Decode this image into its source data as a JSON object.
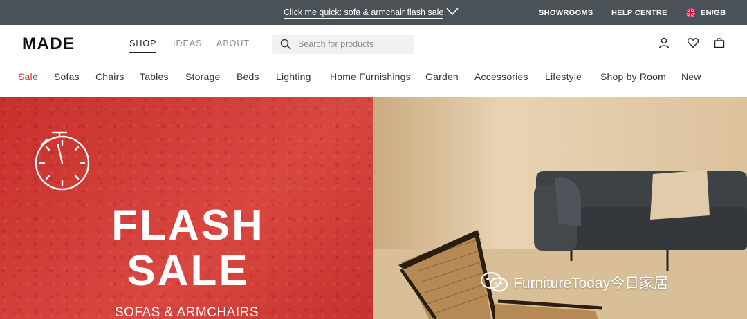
{
  "promo": {
    "text": "Click me quick: sofa & armchair flash sale",
    "showrooms": "SHOWROOMS",
    "help": "HELP CENTRE",
    "locale": "EN/GB"
  },
  "header": {
    "logo": "MADE",
    "tabs": [
      "SHOP",
      "IDEAS",
      "ABOUT"
    ],
    "search_placeholder": "Search for products"
  },
  "categories": [
    "Sale",
    "Sofas",
    "Chairs",
    "Tables",
    "Storage",
    "Beds",
    "Lighting",
    "Home Furnishings",
    "Garden",
    "Accessories",
    "Lifestyle",
    "Shop by Room",
    "New"
  ],
  "hero": {
    "title_line1": "FLASH",
    "title_line2": "SALE",
    "subtitle": "SOFAS & ARMCHAIRS",
    "watermark": "FurnitureToday今日家居"
  },
  "colors": {
    "promo_bg": "#4a5157",
    "sale_red": "#c8342f",
    "hero_red": "#cf3b36"
  }
}
